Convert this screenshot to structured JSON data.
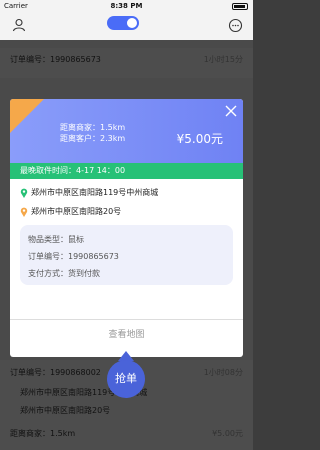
{
  "status_bar": {
    "carrier": "Carrier",
    "time": "8:38 PM"
  },
  "background_orders": [
    {
      "order_label": "订单编号：",
      "order_no": "1990865673",
      "eta": "1小时15分"
    },
    {
      "order_label": "订单编号：",
      "order_no": "1990868002",
      "eta": "1小时08分",
      "addr1": "郑州市中原区南阳路119号中州商城",
      "addr2": "郑州市中原区南阳路20号",
      "distance_label": "距离商家：",
      "distance": "1.5km",
      "price": "¥5.00元"
    }
  ],
  "modal": {
    "distance_shop_label": "距离商家：",
    "distance_shop": "1.5km",
    "distance_customer_label": "距离客户：",
    "distance_customer": "2.3km",
    "price": "¥5.00元",
    "deadline_label": "最晚取件时间：",
    "deadline": "4-17 14：00",
    "pickup_address": "郑州市中原区南阳路119号中州商城",
    "delivery_address": "郑州市中原区南阳路20号",
    "item_type_label": "物品类型：",
    "item_type": "鼠标",
    "order_no_label": "订单编号：",
    "order_no": "1990865673",
    "payment_label": "支付方式：",
    "payment": "货到付款",
    "map_button": "查看地图"
  },
  "grab_button": "抢单",
  "colors": {
    "accent": "#4a6cf7",
    "green": "#27c177",
    "orange": "#f5a84a",
    "price_red": "#b71c1c"
  }
}
